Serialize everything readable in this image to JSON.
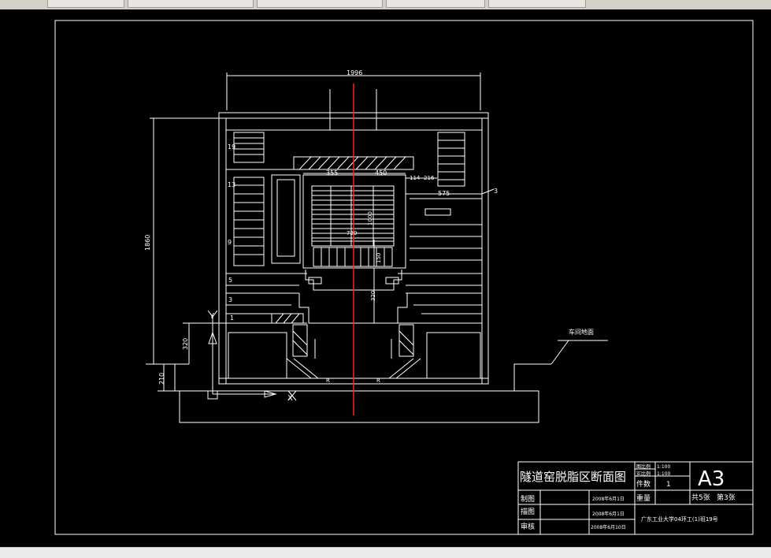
{
  "taskbar": {
    "items": [
      "",
      "",
      "",
      "",
      ""
    ]
  },
  "drawing": {
    "dimensions": {
      "top_width": "1996",
      "left_height": "1860",
      "left_lower": "320",
      "left_bottom": "210",
      "inner_left": "355",
      "inner_right": "450",
      "right_a": "114",
      "right_b": "216",
      "right_c": "575",
      "center_v1": "1000",
      "center_h": "720",
      "center_v2": "150",
      "center_v3": "320",
      "bottom_left_r": "R",
      "bottom_right_r": "R"
    },
    "layer_numbers": [
      "19",
      "13",
      "9",
      "5",
      "3",
      "1"
    ],
    "callout_number": "3",
    "ground_label": "车间地面",
    "axis_y": "Y",
    "axis_x": "X",
    "colors": {
      "background": "#000000",
      "lines": "#ffffff",
      "centerline": "#ff0000"
    }
  },
  "title_block": {
    "title": "隧道窑脱脂区断面图",
    "scale_label_1": "图比例",
    "scale_value_1": "1:100",
    "scale_label_2": "实比例",
    "scale_value_2": "1:100",
    "quantity_label": "件数",
    "quantity_value": "1",
    "sheet_size": "A3",
    "weight_label": "重量",
    "sheet_count": "共5张",
    "sheet_index": "第3张",
    "drawn_label": "制图",
    "drawn_date": "2008年6月1日",
    "traced_label": "描图",
    "traced_date": "2008年6月1日",
    "checked_label": "审核",
    "checked_date": "2008年6月10日",
    "school": "广东工业大学04环工(1)班19号"
  }
}
